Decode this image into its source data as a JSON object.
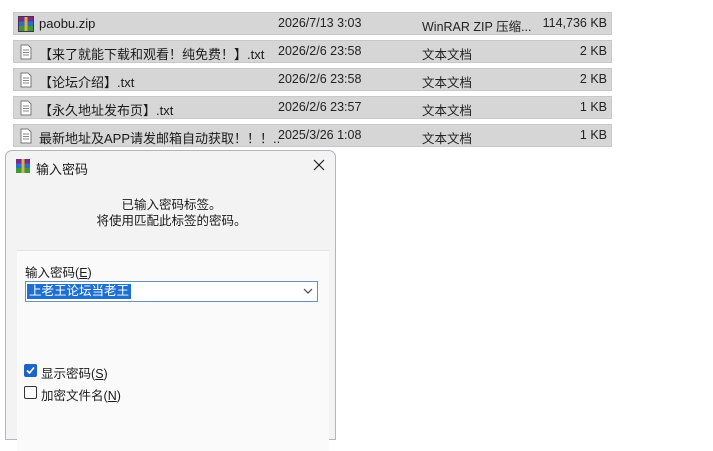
{
  "files": [
    {
      "name": "paobu.zip",
      "date": "2026/7/13 3:03",
      "type": "WinRAR ZIP 压缩...",
      "size": "114,736 KB",
      "icon": "winrar-archive-icon"
    },
    {
      "name": "【来了就能下载和观看！纯免费！】.txt",
      "date": "2026/2/6 23:58",
      "type": "文本文档",
      "size": "2 KB",
      "icon": "text-file-icon"
    },
    {
      "name": "【论坛介绍】.txt",
      "date": "2026/2/6 23:58",
      "type": "文本文档",
      "size": "2 KB",
      "icon": "text-file-icon"
    },
    {
      "name": "【永久地址发布页】.txt",
      "date": "2026/2/6 23:57",
      "type": "文本文档",
      "size": "1 KB",
      "icon": "text-file-icon"
    },
    {
      "name": "最新地址及APP请发邮箱自动获取！！！....",
      "date": "2025/3/26 1:08",
      "type": "文本文档",
      "size": "1 KB",
      "icon": "text-file-icon"
    }
  ],
  "dialog": {
    "title": "输入密码",
    "message_line1": "已输入密码标签。",
    "message_line2": "将使用匹配此标签的密码。",
    "password_label": "输入密码",
    "password_hotkey": "E",
    "password_value": "上老王论坛当老王",
    "show_password_label": "显示密码",
    "show_password_hotkey": "S",
    "show_password_checked": true,
    "encrypt_names_label": "加密文件名",
    "encrypt_names_hotkey": "N",
    "encrypt_names_checked": false
  },
  "colors": {
    "selection": "#1e6fd2",
    "row_bg": "#d6d6d6",
    "dialog_bg": "#f3f3f3",
    "checkbox_on": "#1d64c4"
  }
}
